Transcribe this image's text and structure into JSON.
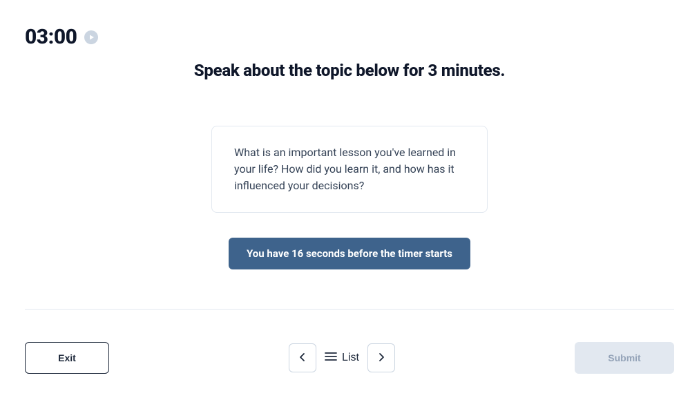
{
  "timer": {
    "display": "03:00"
  },
  "instruction": "Speak about the topic below for 3 minutes.",
  "topic": {
    "prompt": "What is an important lesson you've learned in your life? How did you learn it, and how has it influenced your decisions?"
  },
  "countdown": {
    "message": "You have 16 seconds before the timer starts"
  },
  "footer": {
    "exit_label": "Exit",
    "list_label": "List",
    "submit_label": "Submit"
  }
}
